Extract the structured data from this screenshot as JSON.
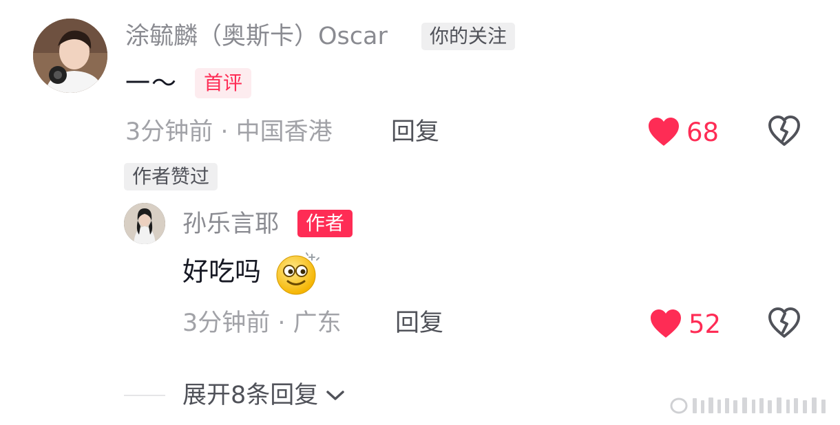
{
  "comment": {
    "username": "涂毓麟（奥斯卡）Oscar",
    "follow_tag": "你的关注",
    "text": "一～",
    "first_tag": "首评",
    "time": "3分钟前",
    "location": "中国香港",
    "meta": "3分钟前 · 中国香港",
    "reply_label": "回复",
    "likes": "68",
    "author_liked_tag": "作者赞过",
    "avatar_icon": "avatar-photo-icon"
  },
  "reply": {
    "username": "孙乐言耶",
    "author_tag": "作者",
    "text": "好吃吗",
    "emoji_icon": "dizzy-eyes-emoji-icon",
    "time": "3分钟前",
    "location": "广东",
    "meta": "3分钟前 · 广东",
    "reply_label": "回复",
    "likes": "52",
    "avatar_icon": "avatar-photo-icon"
  },
  "expand": {
    "label": "展开8条回复"
  },
  "colors": {
    "accent_red": "#fe2c55",
    "muted_text": "#a1a2a7",
    "primary_text": "#161823"
  }
}
